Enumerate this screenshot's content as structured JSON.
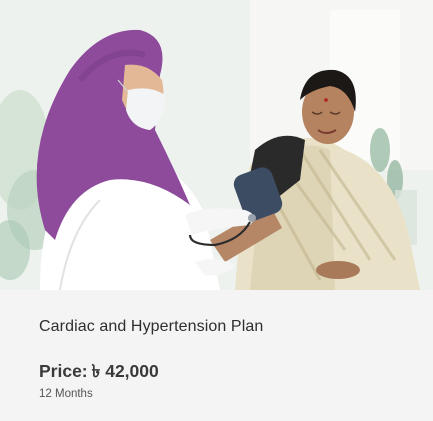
{
  "plan": {
    "image_alt": "Nurse measuring blood pressure of a patient",
    "title": "Cardiac and Hypertension Plan",
    "price_label": "Price:",
    "price_value": "৳ 42,000",
    "duration": "12 Months"
  },
  "colors": {
    "hijab": "#8e4b9c",
    "coat": "#ffffff",
    "saree": "#e9e2c8",
    "blouse": "#2a2a2a",
    "cuff": "#3b4c63",
    "card_bg": "#f4f4f4",
    "title_text": "#2e2e2e",
    "price_text": "#3a3a3a"
  }
}
